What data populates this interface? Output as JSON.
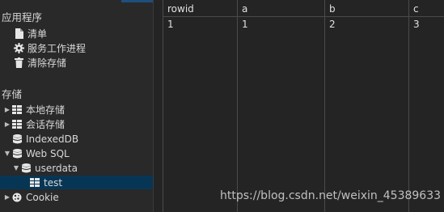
{
  "sidebar": {
    "app_section": {
      "title": "应用程序",
      "items": [
        {
          "label": "清单",
          "icon": "file-icon"
        },
        {
          "label": "服务工作进程",
          "icon": "gear-icon"
        },
        {
          "label": "清除存储",
          "icon": "trash-icon"
        }
      ]
    },
    "storage_section": {
      "title": "存储",
      "items": [
        {
          "label": "本地存储",
          "icon": "grid-icon",
          "expandable": true
        },
        {
          "label": "会话存储",
          "icon": "grid-icon",
          "expandable": true
        },
        {
          "label": "IndexedDB",
          "icon": "database-icon"
        },
        {
          "label": "Web SQL",
          "icon": "database-icon",
          "expanded": true
        },
        {
          "label": "userdata",
          "icon": "database-icon",
          "expanded": true
        },
        {
          "label": "test",
          "icon": "grid-icon",
          "selected": true
        },
        {
          "label": "Cookie",
          "icon": "cookie-icon",
          "expandable": true
        }
      ]
    }
  },
  "table": {
    "columns": [
      "rowid",
      "a",
      "b",
      "c"
    ],
    "rows": [
      [
        "1",
        "1",
        "2",
        "3"
      ]
    ]
  },
  "watermark": "https://blog.csdn.net/weixin_45389633",
  "colors": {
    "background": "#242424",
    "sidebar": "#292929",
    "selected": "#073655",
    "accent": "#1e4f7f"
  }
}
